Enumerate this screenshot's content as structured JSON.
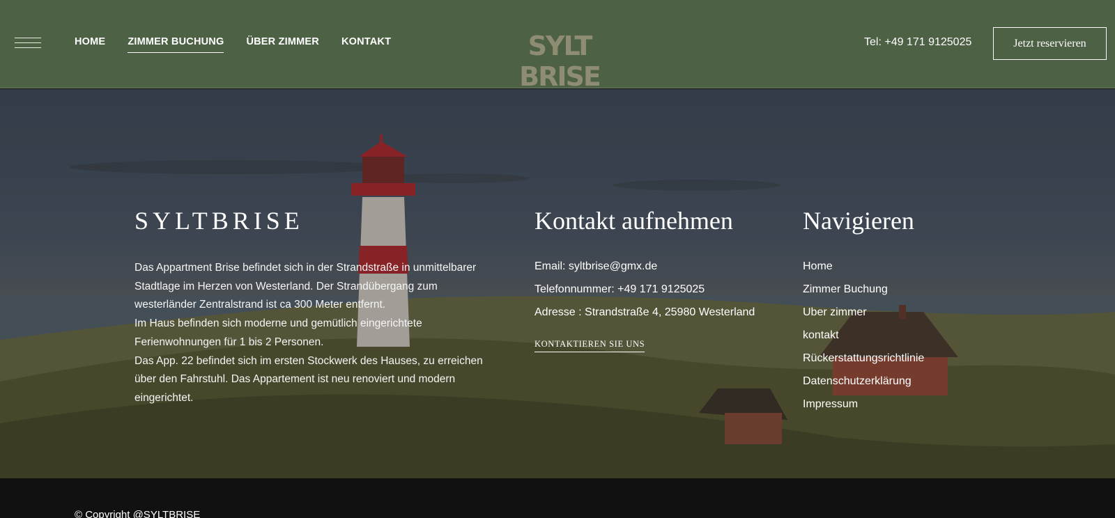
{
  "header": {
    "nav": [
      "HOME",
      "ZIMMER BUCHUNG",
      "ÜBER ZIMMER",
      "KONTAKT"
    ],
    "active_nav": "ZIMMER BUCHUNG",
    "logo": "SYLT BRISE",
    "phone": "Tel: +49 171 9125025",
    "reserve_label": "Jetzt reservieren"
  },
  "about": {
    "title": "SYLTBRISE",
    "paragraphs": [
      "Das Appartment Brise befindet sich in der Strandstraße in unmittelbarer Stadtlage im Herzen von Westerland. Der Strandübergang zum westerländer Zentralstrand ist ca 300 Meter entfernt.",
      "Im Haus befinden sich moderne und gemütlich eingerichtete Ferienwohnungen für 1 bis 2 Personen.",
      "Das App. 22 befindet sich im ersten Stockwerk des Hauses, zu erreichen über den Fahrstuhl. Das Appartement ist neu renoviert und modern eingerichtet."
    ]
  },
  "contact": {
    "title": "Kontakt aufnehmen",
    "email": "Email: syltbrise@gmx.de",
    "phone": "Telefonnummer: +49 171 9125025",
    "address": "Adresse : Strandstraße 4, 25980 Westerland",
    "link": "KONTAKTIEREN SIE UNS"
  },
  "navigate": {
    "title": "Navigieren",
    "items": [
      "Home",
      "Zimmer Buchung",
      "Uber zimmer",
      "kontakt",
      "Rückerstattungsrichtlinie",
      "Datenschutzerklärung",
      "Impressum"
    ]
  },
  "footer": {
    "copyright": "© Copyright @SYLTBRISE"
  },
  "colors": {
    "header_bg": "#4d6145",
    "logo": "#8f8c74",
    "bottom_bar": "#111111"
  }
}
